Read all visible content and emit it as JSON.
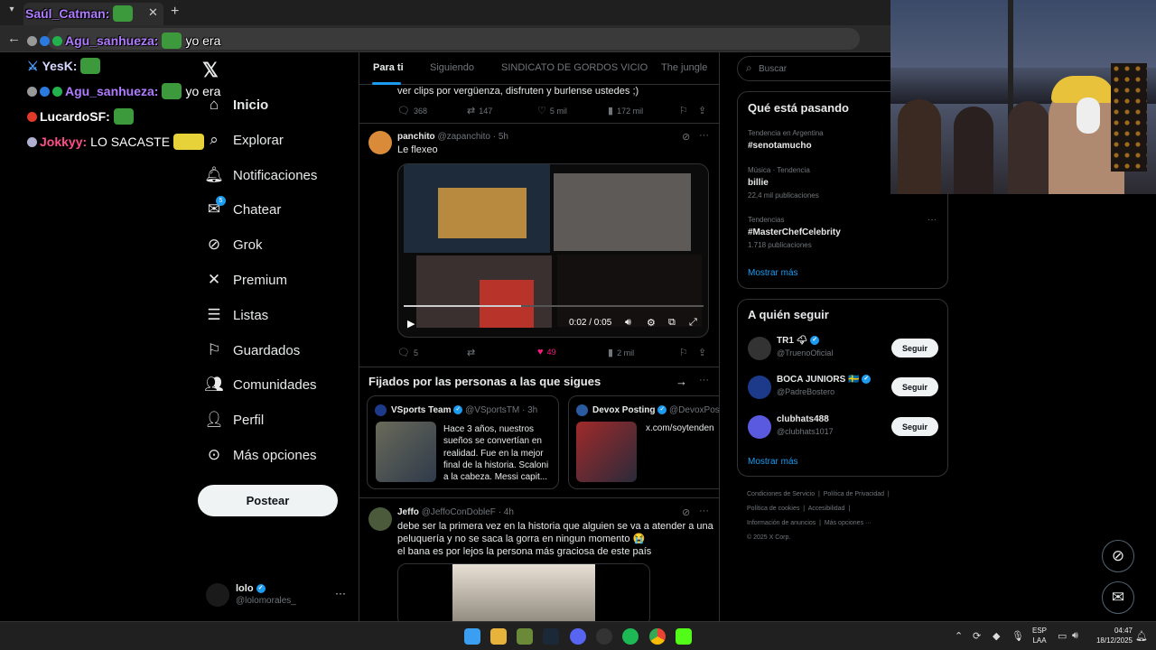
{
  "chat": [
    {
      "user": "Saúl_Catman:",
      "color": "#b07cff",
      "message": ""
    },
    {
      "user": "Agu_sanhueza:",
      "color": "#b07cff",
      "message": "yo era"
    },
    {
      "user": "YesK:",
      "color": "#d8d8ff",
      "message": ""
    },
    {
      "user": "Agu_sanhueza:",
      "color": "#b07cff",
      "message": "yo era"
    },
    {
      "user": "LucardoSF:",
      "color": "#ffffff",
      "message": ""
    },
    {
      "user": "Jokkyy:",
      "color": "#ff4d8a",
      "message": "LO SACASTE"
    }
  ],
  "nav": {
    "items": [
      {
        "label": "Inicio",
        "icon": "home-icon"
      },
      {
        "label": "Explorar",
        "icon": "search-icon"
      },
      {
        "label": "Notificaciones",
        "icon": "bell-icon"
      },
      {
        "label": "Chatear",
        "icon": "mail-icon",
        "badge": "5"
      },
      {
        "label": "Grok",
        "icon": "grok-icon"
      },
      {
        "label": "Premium",
        "icon": "x-icon"
      },
      {
        "label": "Listas",
        "icon": "list-icon"
      },
      {
        "label": "Guardados",
        "icon": "bookmark-icon"
      },
      {
        "label": "Comunidades",
        "icon": "people-icon"
      },
      {
        "label": "Perfil",
        "icon": "person-icon"
      },
      {
        "label": "Más opciones",
        "icon": "more-icon"
      }
    ],
    "post_label": "Postear",
    "account": {
      "name": "lolo",
      "handle": "@lolomorales_"
    }
  },
  "feed": {
    "tabs": [
      "Para ti",
      "Siguiendo",
      "SINDICATO DE GORDOS VICIO",
      "The jungle"
    ],
    "tweet0": {
      "text": "ver clips por vergüenza, disfruten y burlense ustedes ;)",
      "replies": "368",
      "retweets": "147",
      "likes": "5 mil",
      "views": "172 mil"
    },
    "tweet1": {
      "name": "panchito",
      "handle": "@zapanchito",
      "time": "· 5h",
      "text": "Le flexeo",
      "video_time": "0:02 / 0:05",
      "replies": "5",
      "retweets": "",
      "likes": "49",
      "views": "2 mil"
    },
    "pinned": {
      "title": "Fijados por las personas a las que sigues",
      "cards": [
        {
          "name": "VSports Team",
          "handle": "@VSportsTM",
          "time": "· 3h",
          "text": "Hace 3 años, nuestros sueños se convertían en realidad. Fue en la mejor final de la historia. Scaloni a la cabeza. Messi capit..."
        },
        {
          "name": "Devox Posting",
          "handle": "@DevoxPos",
          "time": "",
          "text": "x.com/soytenden"
        }
      ]
    },
    "tweet2": {
      "name": "Jeffo",
      "handle": "@JeffoConDobleF",
      "time": "· 4h",
      "line1": "debe ser la primera vez en la historia que alguien se va a atender a una",
      "line2": "peluquería y no se saca la gorra en ningun momento 😭",
      "line3": "el bana es por lejos la persona más graciosa de este país"
    }
  },
  "right": {
    "search_placeholder": "Buscar",
    "trends_title": "Qué está pasando",
    "trends": [
      {
        "meta": "Tendencia en Argentina",
        "name": "#senotamucho",
        "count": ""
      },
      {
        "meta": "Música · Tendencia",
        "name": "billie",
        "count": "22,4 mil publicaciones"
      },
      {
        "meta": "Tendencias",
        "name": "#MasterChefCelebrity",
        "count": "1.718 publicaciones"
      }
    ],
    "show_more": "Mostrar más",
    "follow_title": "A quién seguir",
    "follow": [
      {
        "name": "TR1 🌩",
        "handle": "@TruenoOficial",
        "color": "#333333"
      },
      {
        "name": "BOCA JUNIORS 🇸🇪",
        "handle": "@PadreBostero",
        "color": "#1d3a8a"
      },
      {
        "name": "clubhats488",
        "handle": "@clubhats1017",
        "color": "#5a5ae0"
      }
    ],
    "follow_label": "Seguir",
    "footer": [
      "Condiciones de Servicio",
      "Política de Privacidad",
      "Política de cookies",
      "Accesibilidad",
      "Información de anuncios",
      "Más opciones ···",
      "© 2025 X Corp."
    ]
  },
  "taskbar": {
    "lang1": "ESP",
    "lang2": "LAA",
    "time": "04:47",
    "date": "18/12/2025"
  }
}
